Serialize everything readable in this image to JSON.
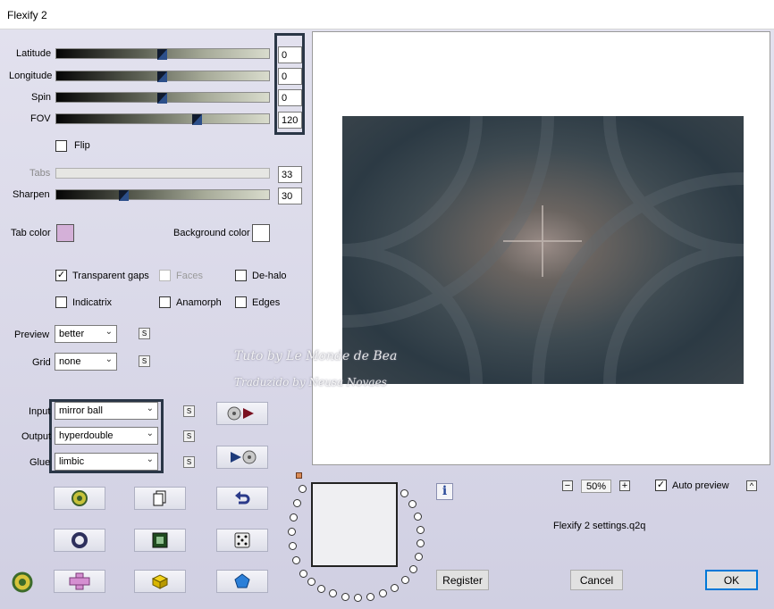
{
  "window": {
    "title": "Flexify 2"
  },
  "sliders": [
    {
      "label": "Latitude",
      "value": "0",
      "fraction": 0.5
    },
    {
      "label": "Longitude",
      "value": "0",
      "fraction": 0.5
    },
    {
      "label": "Spin",
      "value": "0",
      "fraction": 0.5
    },
    {
      "label": "FOV",
      "value": "120",
      "fraction": 0.66
    }
  ],
  "flip": {
    "label": "Flip",
    "checked": false
  },
  "tabs": {
    "label": "Tabs",
    "value": "33"
  },
  "sharpen": {
    "label": "Sharpen",
    "value": "30",
    "fraction": 0.3
  },
  "tab_color": {
    "label": "Tab color",
    "color": "#d4b0d8"
  },
  "background_color": {
    "label": "Background color",
    "color": "#ffffff"
  },
  "options": {
    "transparent_gaps": {
      "label": "Transparent gaps",
      "checked": true
    },
    "faces": {
      "label": "Faces",
      "checked": false
    },
    "de_halo": {
      "label": "De-halo",
      "checked": false
    },
    "indicatrix": {
      "label": "Indicatrix",
      "checked": false
    },
    "anamorph": {
      "label": "Anamorph",
      "checked": false
    },
    "edges": {
      "label": "Edges",
      "checked": false
    }
  },
  "preview_select": {
    "label": "Preview",
    "value": "better"
  },
  "grid_select": {
    "label": "Grid",
    "value": "none"
  },
  "input_select": {
    "label": "Input",
    "value": "mirror ball"
  },
  "output_select": {
    "label": "Output",
    "value": "hyperdouble"
  },
  "glue_select": {
    "label": "Glue",
    "value": "limbic"
  },
  "s_label": "S",
  "info_label": "i",
  "zoom": {
    "minus": "−",
    "value": "50%",
    "plus": "+"
  },
  "auto_preview": {
    "label": "Auto preview",
    "checked": true,
    "collapse": "^"
  },
  "settings_file": "Flexify 2 settings.q2q",
  "buttons": {
    "register": "Register",
    "cancel": "Cancel",
    "ok": "OK"
  },
  "watermark": {
    "line1": "Tuto by Le Monde de Bea",
    "line2": "Traduzido by Neusa Novaes"
  },
  "colors": {
    "accent": "#0078d7",
    "highlight_border": "#2a3646"
  }
}
